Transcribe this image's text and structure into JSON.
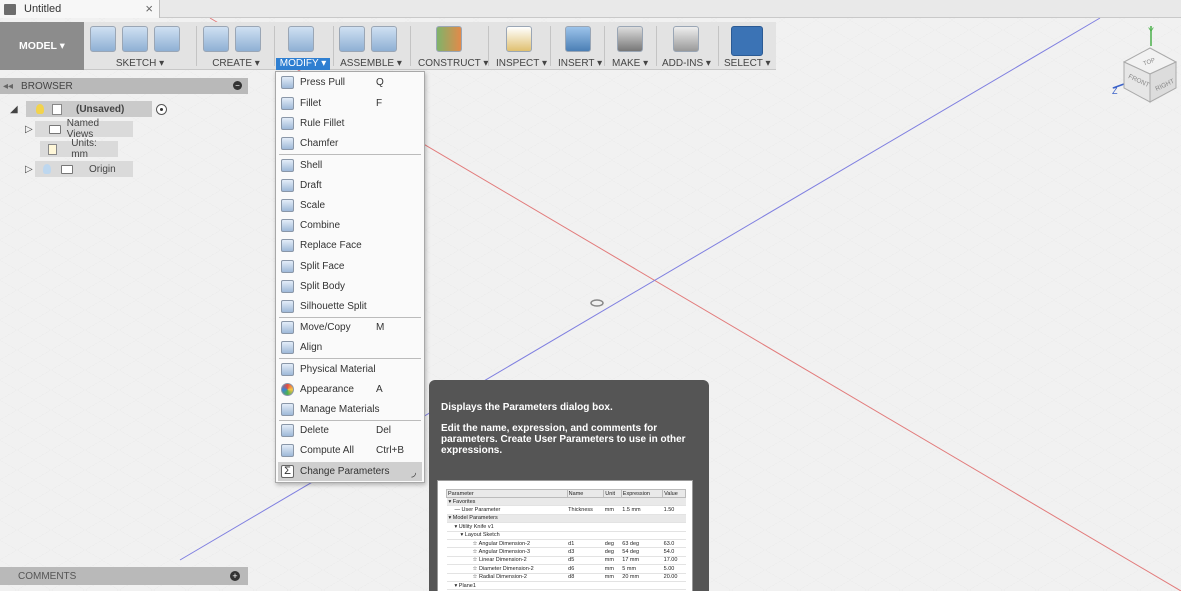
{
  "document_tab": {
    "title": "Untitled",
    "close_glyph": "×"
  },
  "toolbar": {
    "workspace_label": "MODEL ▾",
    "groups": {
      "sketch": "SKETCH ▾",
      "create": "CREATE ▾",
      "modify": "MODIFY ▾",
      "assemble": "ASSEMBLE ▾",
      "construct": "CONSTRUCT ▾",
      "inspect": "INSPECT ▾",
      "insert": "INSERT ▾",
      "make": "MAKE ▾",
      "addins": "ADD-INS ▾",
      "select": "SELECT ▾"
    }
  },
  "browser": {
    "header": "BROWSER",
    "root": "(Unsaved)",
    "named_views": "Named Views",
    "units": "Units: mm",
    "origin": "Origin"
  },
  "comments": {
    "label": "COMMENTS"
  },
  "viewcube": {
    "top": "TOP",
    "front": "FRONT",
    "right": "RIGHT",
    "y": "Y",
    "z": "Z"
  },
  "modify_menu": {
    "items": [
      {
        "label": "Press Pull",
        "shortcut": "Q",
        "icon": "press-pull-icon"
      },
      {
        "label": "Fillet",
        "shortcut": "F",
        "icon": "fillet-icon"
      },
      {
        "label": "Rule Fillet",
        "shortcut": "",
        "icon": "rule-fillet-icon"
      },
      {
        "label": "Chamfer",
        "shortcut": "",
        "icon": "chamfer-icon"
      },
      {
        "label": "Shell",
        "shortcut": "",
        "icon": "shell-icon"
      },
      {
        "label": "Draft",
        "shortcut": "",
        "icon": "draft-icon"
      },
      {
        "label": "Scale",
        "shortcut": "",
        "icon": "scale-icon"
      },
      {
        "label": "Combine",
        "shortcut": "",
        "icon": "combine-icon"
      },
      {
        "label": "Replace Face",
        "shortcut": "",
        "icon": "replace-face-icon"
      },
      {
        "label": "Split Face",
        "shortcut": "",
        "icon": "split-face-icon"
      },
      {
        "label": "Split Body",
        "shortcut": "",
        "icon": "split-body-icon"
      },
      {
        "label": "Silhouette Split",
        "shortcut": "",
        "icon": "silhouette-split-icon"
      },
      {
        "label": "Move/Copy",
        "shortcut": "M",
        "icon": "move-copy-icon"
      },
      {
        "label": "Align",
        "shortcut": "",
        "icon": "align-icon"
      },
      {
        "label": "Physical Material",
        "shortcut": "",
        "icon": "physical-material-icon"
      },
      {
        "label": "Appearance",
        "shortcut": "A",
        "icon": "appearance-icon"
      },
      {
        "label": "Manage Materials",
        "shortcut": "",
        "icon": "manage-materials-icon"
      },
      {
        "label": "Delete",
        "shortcut": "Del",
        "icon": "delete-icon"
      },
      {
        "label": "Compute All",
        "shortcut": "Ctrl+B",
        "icon": "compute-all-icon"
      },
      {
        "label": "Change Parameters",
        "shortcut": "",
        "icon": "change-parameters-icon"
      }
    ]
  },
  "tooltip": {
    "line1": "Displays the Parameters dialog box.",
    "line2": "Edit the name, expression, and comments for parameters. Create User Parameters to use in other expressions.",
    "preview": {
      "headers": [
        "Parameter",
        "Name",
        "Unit",
        "Expression",
        "Value"
      ],
      "rows": [
        [
          "▾ Favorites",
          "",
          "",
          "",
          ""
        ],
        [
          "— User Parameter",
          "Thickness",
          "mm",
          "1.5 mm",
          "1.50"
        ],
        [
          "▾ Model Parameters",
          "",
          "",
          "",
          ""
        ],
        [
          "▾ Utility Knife v1",
          "",
          "",
          "",
          ""
        ],
        [
          "▾ Layout Sketch",
          "",
          "",
          "",
          ""
        ],
        [
          "☆ Angular Dimension-2",
          "d1",
          "deg",
          "63 deg",
          "63.0"
        ],
        [
          "☆ Angular Dimension-3",
          "d3",
          "deg",
          "54 deg",
          "54.0"
        ],
        [
          "☆ Linear Dimension-2",
          "d5",
          "mm",
          "17 mm",
          "17.00"
        ],
        [
          "☆ Diameter Dimension-2",
          "d6",
          "mm",
          "5 mm",
          "5.00"
        ],
        [
          "☆ Radial Dimension-2",
          "d8",
          "mm",
          "20 mm",
          "20.00"
        ],
        [
          "▾ Plane1",
          "",
          "",
          "",
          ""
        ]
      ]
    }
  }
}
